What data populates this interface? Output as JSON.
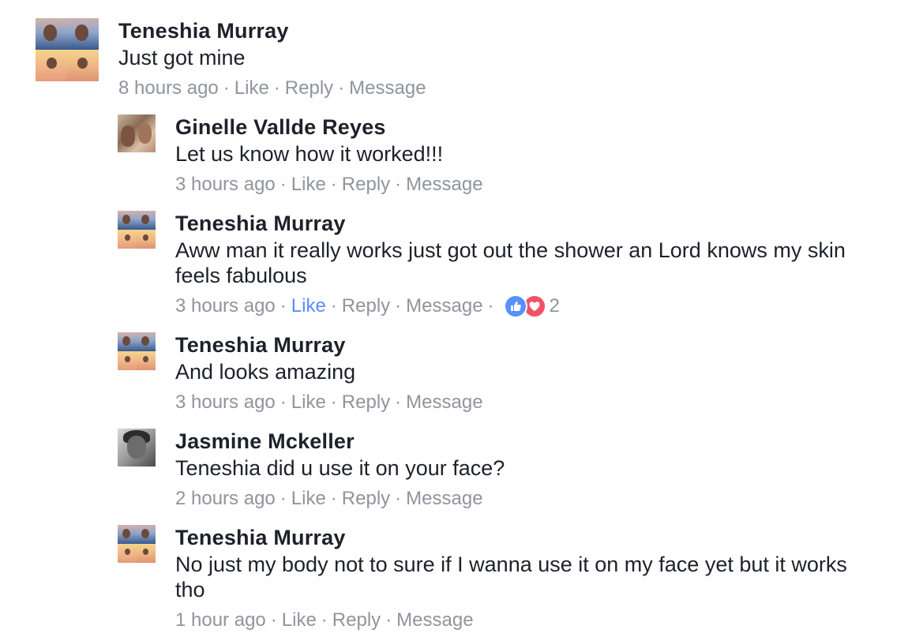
{
  "comments": [
    {
      "name": "Teneshia Murray",
      "text": "Just got mine",
      "time": "8 hours ago",
      "like": "Like",
      "reply": "Reply",
      "message": "Message"
    },
    {
      "name": "Ginelle Vallde Reyes",
      "text": "Let us know how it worked!!!",
      "time": "3 hours ago",
      "like": "Like",
      "reply": "Reply",
      "message": "Message"
    },
    {
      "name": "Teneshia Murray",
      "text": "Aww man it really works just got out the shower an Lord knows my skin feels fabulous",
      "time": "3 hours ago",
      "like": "Like",
      "reply": "Reply",
      "message": "Message",
      "reaction_count": "2",
      "reaction_icons": [
        "like-icon",
        "love-icon"
      ],
      "like_active_color": "#598dfb"
    },
    {
      "name": "Teneshia Murray",
      "text": "And looks amazing",
      "time": "3 hours ago",
      "like": "Like",
      "reply": "Reply",
      "message": "Message"
    },
    {
      "name": "Jasmine Mckeller",
      "text": "Teneshia did u use it on your face?",
      "time": "2 hours ago",
      "like": "Like",
      "reply": "Reply",
      "message": "Message"
    },
    {
      "name": "Teneshia Murray",
      "text": "No just my body not to sure if I wanna use it on my face yet but it works tho",
      "time": "1 hour ago",
      "like": "Like",
      "reply": "Reply",
      "message": "Message"
    }
  ],
  "separator": "·",
  "colors": {
    "name": "#1d2129",
    "meta": "#90949c",
    "like_reaction": "#5890ff",
    "love_reaction": "#f25268"
  }
}
